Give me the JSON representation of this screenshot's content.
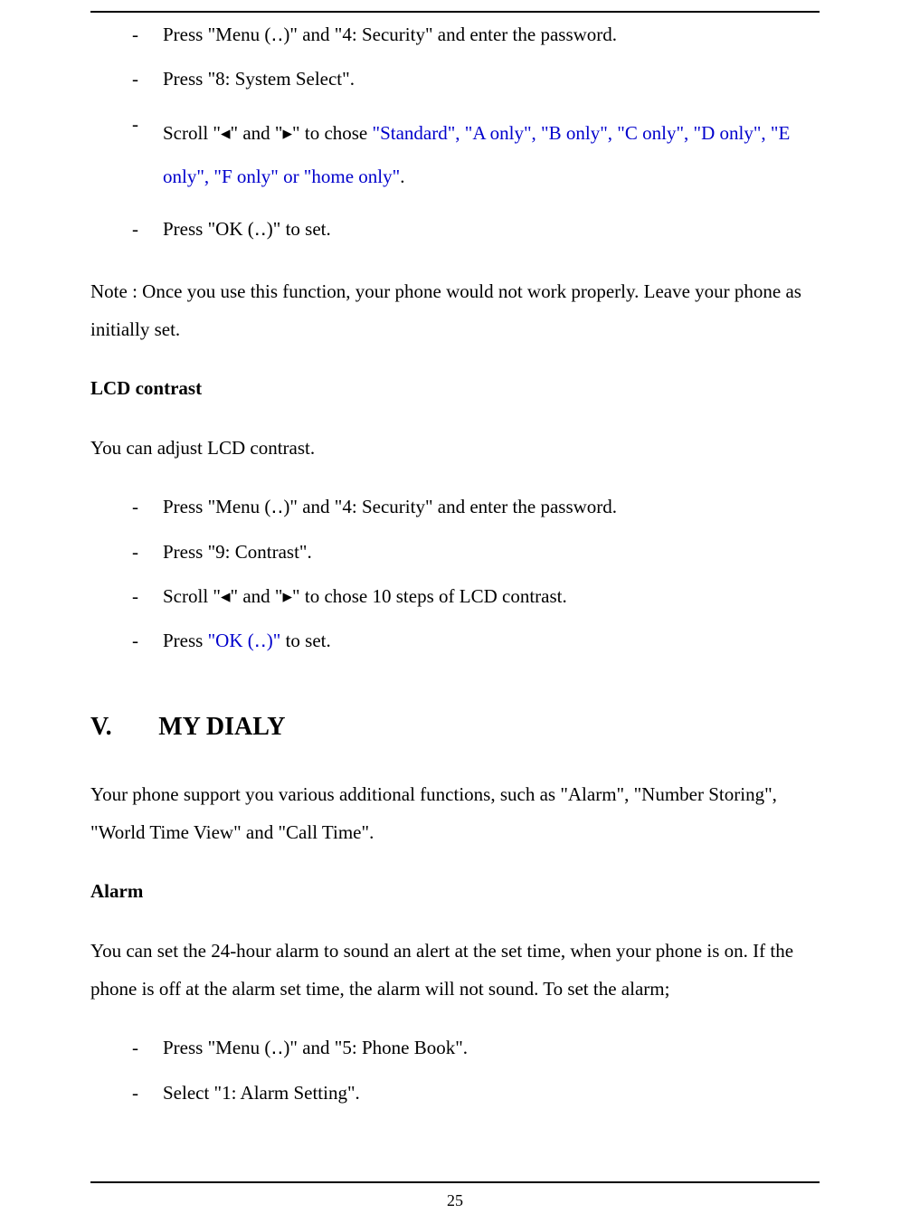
{
  "list1": {
    "item1": "Press \"Menu (‥)\" and \"4: Security\" and enter the password.",
    "item2": "Press \"8: System Select\".",
    "item3_prefix": "Scroll \"◂\" and \"▸\" to chose ",
    "item3_options": "\"Standard\", \"A only\", \"B only\", \"C only\", \"D only\", \"E only\", \"F only\" or \"home only\"",
    "item3_suffix": ".",
    "item4": "Press \"OK (‥)\" to set."
  },
  "note_text": "Note : Once you use this function, your phone would not work properly. Leave your phone as initially set.",
  "lcd": {
    "heading": "LCD contrast",
    "intro": "You can adjust LCD contrast.",
    "item1": "Press \"Menu (‥)\" and \"4: Security\" and enter the password.",
    "item2": "Press \"9: Contrast\".",
    "item3": "Scroll \"◂\" and \"▸\" to chose 10 steps of LCD contrast.",
    "item4_prefix": "Press ",
    "item4_ok": "\"OK (‥)\"",
    "item4_suffix": " to set."
  },
  "chapter": {
    "num": "V.",
    "title": "MY DIALY",
    "intro": "Your phone support you various additional functions, such as \"Alarm\", \"Number Storing\", \"World Time View\" and \"Call Time\"."
  },
  "alarm": {
    "heading": "Alarm",
    "intro": "You can set the 24-hour alarm to sound an alert at the set time, when your phone is on. If the phone is off at the alarm set time, the alarm will not sound. To set the alarm;",
    "item1": "Press \"Menu (‥)\" and \"5: Phone Book\".",
    "item2": "Select \"1: Alarm Setting\"."
  },
  "page_number": "25"
}
